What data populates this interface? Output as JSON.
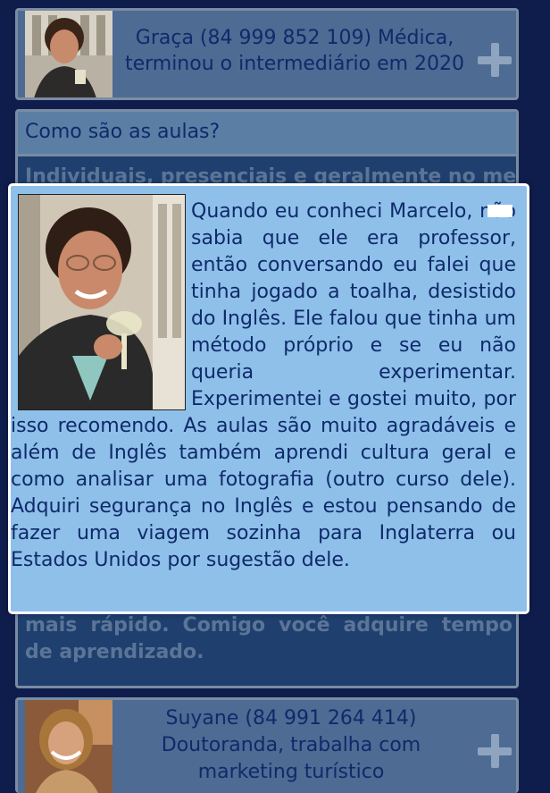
{
  "testimonial_top": {
    "caption": "Graça (84 999 852 109) Médica, terminou o intermediário em 2020",
    "photo_icon": "person-photo",
    "expand_icon": "plus-icon"
  },
  "faq": {
    "question": "Como são as aulas?",
    "answer_start": "Individuais, presenciais e geralmente no meu",
    "answer_end": "mais rápido. Comigo você adquire tempo de aprendizado."
  },
  "testimonial_bottom": {
    "caption": "Suyane (84 991 264 414) Doutoranda, trabalha com marketing turístico",
    "photo_icon": "person-photo",
    "expand_icon": "plus-icon"
  },
  "modal": {
    "testimonial": "Quando eu conheci Marcelo, não sabia que ele era professor, então conversando eu falei que tinha jogado a toalha, desistido do Inglês. Ele falou que tinha um método próprio e se eu não queria experimentar. Experimentei e gostei muito, por isso recomendo. As aulas são muito agradáveis e além de Inglês também aprendi cultura geral e como analisar uma fotografia (outro curso dele). Adquiri segurança no Inglês e estou pensando de fazer uma viagem sozinha para Inglaterra ou Estados Unidos por sugestão dele.",
    "close_icon": "close-icon"
  },
  "colors": {
    "page_background": "#0f1d4d",
    "card_background": "#4d6b93",
    "modal_background": "#8fc0ea",
    "text": "#0f2a6a"
  }
}
